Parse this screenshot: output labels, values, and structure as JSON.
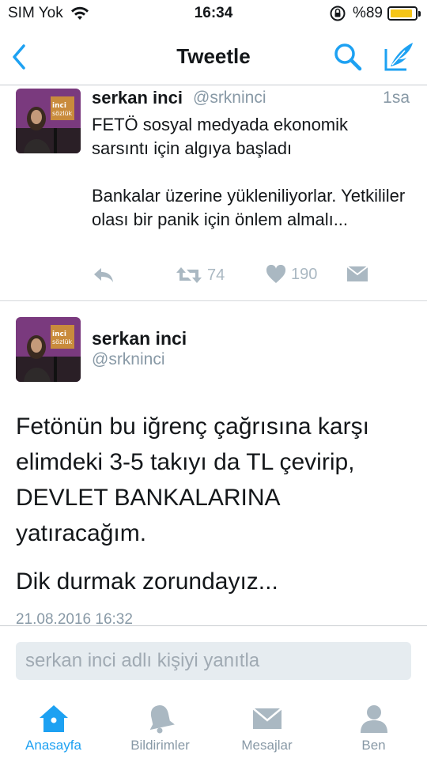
{
  "status_bar": {
    "carrier": "SIM Yok",
    "time": "16:34",
    "battery": "%89",
    "battery_level": 0.89,
    "battery_color": "#f5c518"
  },
  "nav": {
    "title": "Tweetle",
    "back_icon": "chevron-left-icon",
    "search_icon": "search-icon",
    "compose_icon": "compose-icon",
    "accent": "#1da1f2"
  },
  "tweet1": {
    "name": "serkan inci",
    "handle": "@srkninci",
    "time": "1sa",
    "text": "FETÖ sosyal medyada ekonomik sarsıntı için algıya başladı\n\nBankalar üzerine yükleniliyorlar. Yetkililer olası bir panik için önlem almalı...",
    "retweets": "74",
    "likes": "190"
  },
  "tweet2": {
    "name": "serkan inci",
    "handle": "@srkninci",
    "text": "Fetönün bu iğrenç çağrısına karşı elimdeki 3-5 takıyı da TL çevirip, DEVLET BANKALARINA yatıracağım.",
    "text2": "Dik durmak zorundayız...",
    "date": "21.08.2016 16:32"
  },
  "reply": {
    "placeholder": "serkan inci adlı kişiyi yanıtla"
  },
  "tabs": [
    {
      "label": "Anasayfa",
      "icon": "home-icon",
      "active": true
    },
    {
      "label": "Bildirimler",
      "icon": "bell-icon",
      "active": false
    },
    {
      "label": "Mesajlar",
      "icon": "envelope-icon",
      "active": false
    },
    {
      "label": "Ben",
      "icon": "profile-icon",
      "active": false
    }
  ]
}
